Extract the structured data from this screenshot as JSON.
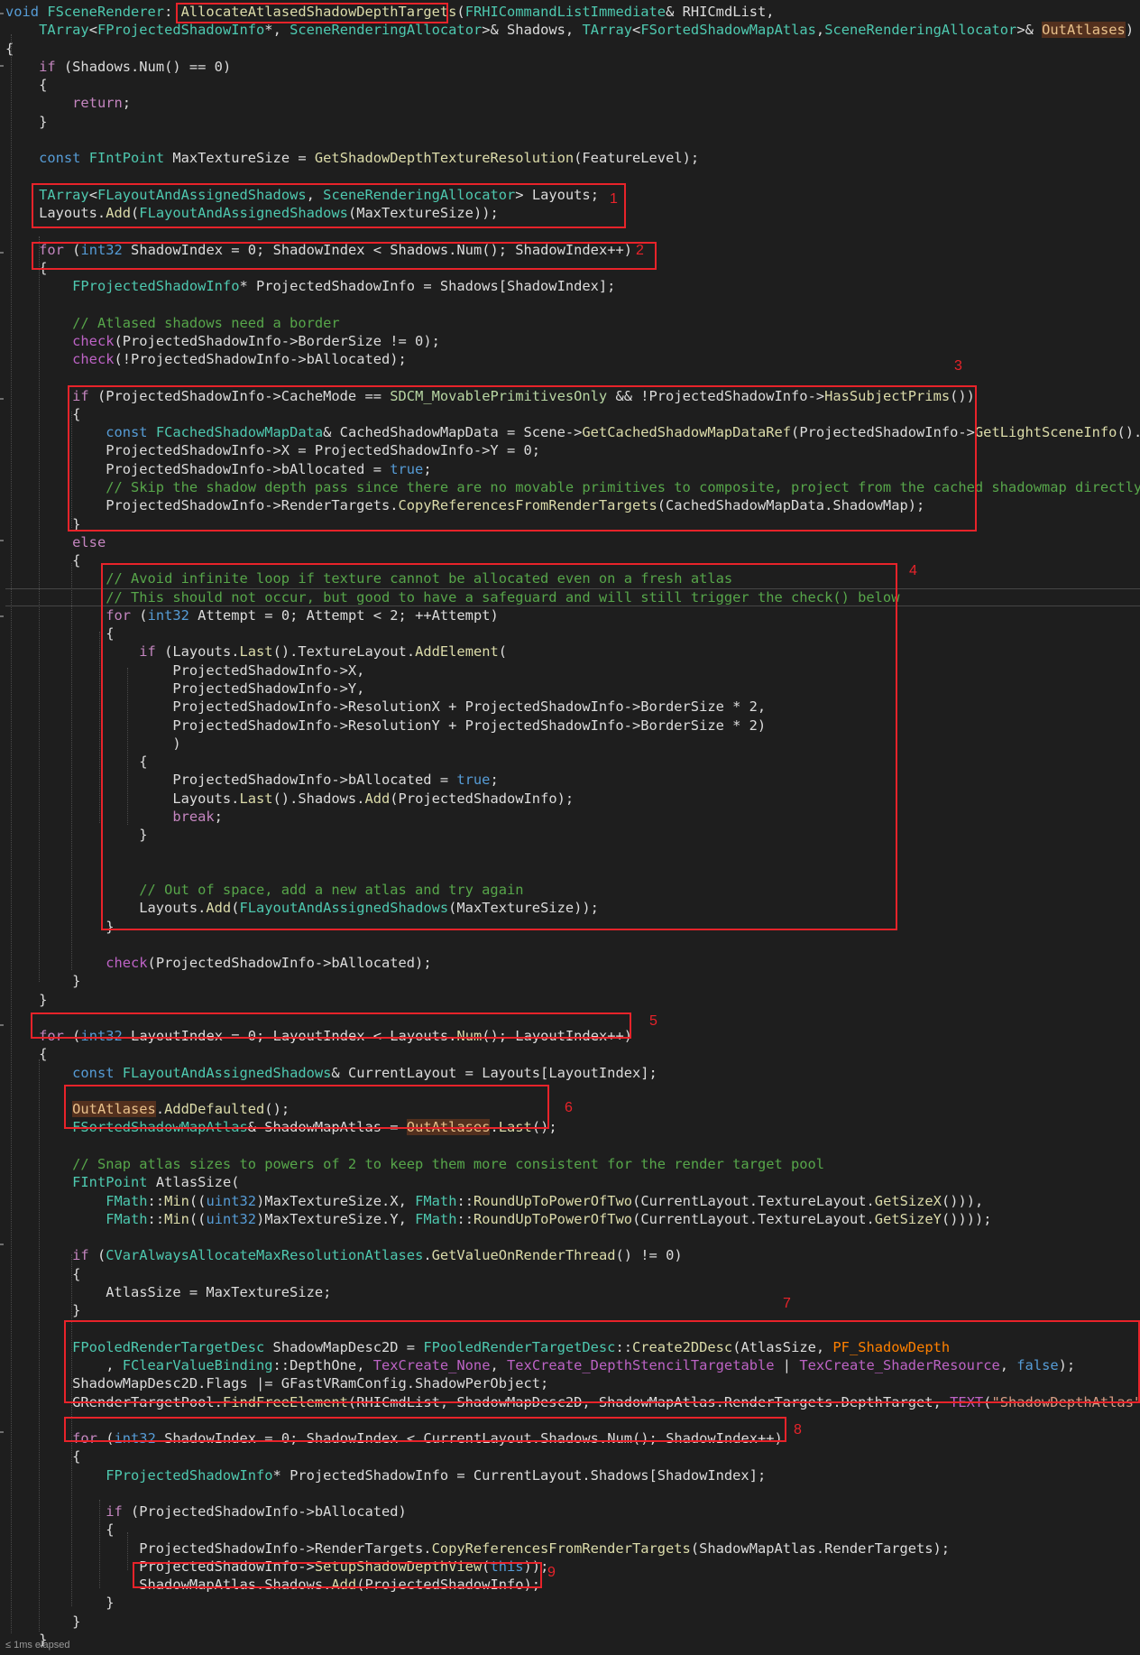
{
  "code": {
    "lines": [
      [
        [
          "k",
          "void "
        ],
        [
          "t",
          "FSceneRenderer"
        ],
        [
          "",
          "::"
        ],
        [
          "f",
          "AllocateAtlasedShadowDepthTargets"
        ],
        [
          "",
          "("
        ],
        [
          "t",
          "FRHICommandListImmediate"
        ],
        [
          "",
          "& RHICmdList,"
        ]
      ],
      [
        [
          "",
          "    "
        ],
        [
          "t",
          "TArray"
        ],
        [
          "",
          "<"
        ],
        [
          "t",
          "FProjectedShadowInfo"
        ],
        [
          "",
          "*, "
        ],
        [
          "t",
          "SceneRenderingAllocator"
        ],
        [
          "",
          ">& Shadows, "
        ],
        [
          "t",
          "TArray"
        ],
        [
          "",
          "<"
        ],
        [
          "t",
          "FSortedShadowMapAtlas"
        ],
        [
          "",
          ","
        ],
        [
          "t",
          "SceneRenderingAllocator"
        ],
        [
          "",
          ">& "
        ],
        [
          "o",
          "OutAtlases"
        ],
        [
          "",
          ")"
        ]
      ],
      [
        [
          "",
          "{"
        ]
      ],
      [
        [
          "",
          "    "
        ],
        [
          "c",
          "if"
        ],
        [
          "",
          " (Shadows.Num() == 0)"
        ]
      ],
      [
        [
          "",
          "    {"
        ]
      ],
      [
        [
          "",
          "        "
        ],
        [
          "c",
          "return"
        ],
        [
          "",
          ";"
        ]
      ],
      [
        [
          "",
          "    }"
        ]
      ],
      [
        [
          "",
          ""
        ]
      ],
      [
        [
          "",
          "    "
        ],
        [
          "k",
          "const "
        ],
        [
          "t",
          "FIntPoint"
        ],
        [
          "",
          " MaxTextureSize = "
        ],
        [
          "f",
          "GetShadowDepthTextureResolution"
        ],
        [
          "",
          "(FeatureLevel);"
        ]
      ],
      [
        [
          "",
          ""
        ]
      ],
      [
        [
          "",
          "    "
        ],
        [
          "t",
          "TArray"
        ],
        [
          "",
          "<"
        ],
        [
          "t",
          "FLayoutAndAssignedShadows"
        ],
        [
          "",
          ", "
        ],
        [
          "t",
          "SceneRenderingAllocator"
        ],
        [
          "",
          "> Layouts;"
        ]
      ],
      [
        [
          "",
          "    Layouts."
        ],
        [
          "f",
          "Add"
        ],
        [
          "",
          "("
        ],
        [
          "t",
          "FLayoutAndAssignedShadows"
        ],
        [
          "",
          "(MaxTextureSize));"
        ]
      ],
      [
        [
          "",
          ""
        ]
      ],
      [
        [
          "",
          "    "
        ],
        [
          "c",
          "for"
        ],
        [
          "",
          " ("
        ],
        [
          "k",
          "int32"
        ],
        [
          "",
          " ShadowIndex = 0; ShadowIndex < Shadows.Num(); ShadowIndex++)"
        ]
      ],
      [
        [
          "",
          "    {"
        ]
      ],
      [
        [
          "",
          "        "
        ],
        [
          "t",
          "FProjectedShadowInfo"
        ],
        [
          "",
          "* ProjectedShadowInfo = Shadows[ShadowIndex];"
        ]
      ],
      [
        [
          "",
          ""
        ]
      ],
      [
        [
          "",
          "        "
        ],
        [
          "g",
          "// Atlased shadows need a border"
        ]
      ],
      [
        [
          "",
          "        "
        ],
        [
          "x",
          "check"
        ],
        [
          "",
          "(ProjectedShadowInfo->BorderSize != 0);"
        ]
      ],
      [
        [
          "",
          "        "
        ],
        [
          "x",
          "check"
        ],
        [
          "",
          "(!ProjectedShadowInfo->bAllocated);"
        ]
      ],
      [
        [
          "",
          ""
        ]
      ],
      [
        [
          "",
          "        "
        ],
        [
          "c",
          "if"
        ],
        [
          "",
          " (ProjectedShadowInfo->CacheMode == "
        ],
        [
          "e",
          "SDCM_MovablePrimitivesOnly"
        ],
        [
          "",
          " && !ProjectedShadowInfo->"
        ],
        [
          "f",
          "HasSubjectPrims"
        ],
        [
          "",
          "())"
        ]
      ],
      [
        [
          "",
          "        {"
        ]
      ],
      [
        [
          "",
          "            "
        ],
        [
          "k",
          "const "
        ],
        [
          "t",
          "FCachedShadowMapData"
        ],
        [
          "",
          "& CachedShadowMapData = Scene->"
        ],
        [
          "f",
          "GetCachedShadowMapDataRef"
        ],
        [
          "",
          "(ProjectedShadowInfo->"
        ],
        [
          "f",
          "GetLightSceneInfo"
        ],
        [
          "",
          "().Id);"
        ]
      ],
      [
        [
          "",
          "            ProjectedShadowInfo->X = ProjectedShadowInfo->Y = 0;"
        ]
      ],
      [
        [
          "",
          "            ProjectedShadowInfo->bAllocated = "
        ],
        [
          "k",
          "true"
        ],
        [
          "",
          ";"
        ]
      ],
      [
        [
          "",
          "            "
        ],
        [
          "g",
          "// Skip the shadow depth pass since there are no movable primitives to composite, project from the cached shadowmap directly which"
        ]
      ],
      [
        [
          "",
          "            ProjectedShadowInfo->RenderTargets."
        ],
        [
          "f",
          "CopyReferencesFromRenderTargets"
        ],
        [
          "",
          "(CachedShadowMapData.ShadowMap);"
        ]
      ],
      [
        [
          "",
          "        }"
        ]
      ],
      [
        [
          "",
          "        "
        ],
        [
          "c",
          "else"
        ]
      ],
      [
        [
          "",
          "        {"
        ]
      ],
      [
        [
          "",
          "            "
        ],
        [
          "g",
          "// Avoid infinite loop if texture cannot be allocated even on a fresh atlas"
        ]
      ],
      [
        [
          "",
          "            "
        ],
        [
          "g",
          "// This should not occur, but good to have a safeguard and will still trigger the check() below"
        ]
      ],
      [
        [
          "",
          "            "
        ],
        [
          "c",
          "for"
        ],
        [
          "",
          " ("
        ],
        [
          "k",
          "int32"
        ],
        [
          "",
          " Attempt = 0; Attempt < 2; ++Attempt)"
        ]
      ],
      [
        [
          "",
          "            {"
        ]
      ],
      [
        [
          "",
          "                "
        ],
        [
          "c",
          "if"
        ],
        [
          "",
          " (Layouts."
        ],
        [
          "f",
          "Last"
        ],
        [
          "",
          "().TextureLayout."
        ],
        [
          "f",
          "AddElement"
        ],
        [
          "",
          "("
        ]
      ],
      [
        [
          "",
          "                    ProjectedShadowInfo->X,"
        ]
      ],
      [
        [
          "",
          "                    ProjectedShadowInfo->Y,"
        ]
      ],
      [
        [
          "",
          "                    ProjectedShadowInfo->ResolutionX + ProjectedShadowInfo->BorderSize * 2,"
        ]
      ],
      [
        [
          "",
          "                    ProjectedShadowInfo->ResolutionY + ProjectedShadowInfo->BorderSize * 2)"
        ]
      ],
      [
        [
          "",
          "                    )"
        ]
      ],
      [
        [
          "",
          "                {"
        ]
      ],
      [
        [
          "",
          "                    ProjectedShadowInfo->bAllocated = "
        ],
        [
          "k",
          "true"
        ],
        [
          "",
          ";"
        ]
      ],
      [
        [
          "",
          "                    Layouts."
        ],
        [
          "f",
          "Last"
        ],
        [
          "",
          "().Shadows."
        ],
        [
          "f",
          "Add"
        ],
        [
          "",
          "(ProjectedShadowInfo);"
        ]
      ],
      [
        [
          "",
          "                    "
        ],
        [
          "c",
          "break"
        ],
        [
          "",
          ";"
        ]
      ],
      [
        [
          "",
          "                }"
        ]
      ],
      [
        [
          "",
          ""
        ]
      ],
      [
        [
          "",
          ""
        ]
      ],
      [
        [
          "",
          "                "
        ],
        [
          "g",
          "// Out of space, add a new atlas and try again"
        ]
      ],
      [
        [
          "",
          "                Layouts."
        ],
        [
          "f",
          "Add"
        ],
        [
          "",
          "("
        ],
        [
          "t",
          "FLayoutAndAssignedShadows"
        ],
        [
          "",
          "(MaxTextureSize));"
        ]
      ],
      [
        [
          "",
          "            }"
        ]
      ],
      [
        [
          "",
          ""
        ]
      ],
      [
        [
          "",
          "            "
        ],
        [
          "x",
          "check"
        ],
        [
          "",
          "(ProjectedShadowInfo->bAllocated);"
        ]
      ],
      [
        [
          "",
          "        }"
        ]
      ],
      [
        [
          "",
          "    }"
        ]
      ],
      [
        [
          "",
          ""
        ]
      ],
      [
        [
          "",
          "    "
        ],
        [
          "c",
          "for"
        ],
        [
          "",
          " ("
        ],
        [
          "k",
          "int32"
        ],
        [
          "",
          " LayoutIndex = 0; LayoutIndex < Layouts."
        ],
        [
          "f",
          "Num"
        ],
        [
          "",
          "(); LayoutIndex++)"
        ]
      ],
      [
        [
          "",
          "    {"
        ]
      ],
      [
        [
          "",
          "        "
        ],
        [
          "k",
          "const "
        ],
        [
          "t",
          "FLayoutAndAssignedShadows"
        ],
        [
          "",
          "& CurrentLayout = Layouts[LayoutIndex];"
        ]
      ],
      [
        [
          "",
          ""
        ]
      ],
      [
        [
          "",
          "        "
        ],
        [
          "o",
          "OutAtlases"
        ],
        [
          "",
          "."
        ],
        [
          "f",
          "AddDefaulted"
        ],
        [
          "",
          "();"
        ]
      ],
      [
        [
          "",
          "        "
        ],
        [
          "t",
          "FSortedShadowMapAtlas"
        ],
        [
          "",
          "& ShadowMapAtlas = "
        ],
        [
          "o",
          "OutAtlases"
        ],
        [
          "",
          "."
        ],
        [
          "f",
          "Last"
        ],
        [
          "",
          "();"
        ]
      ],
      [
        [
          "",
          ""
        ]
      ],
      [
        [
          "",
          "        "
        ],
        [
          "g",
          "// Snap atlas sizes to powers of 2 to keep them more consistent for the render target pool"
        ]
      ],
      [
        [
          "",
          "        "
        ],
        [
          "t",
          "FIntPoint"
        ],
        [
          "",
          " AtlasSize("
        ]
      ],
      [
        [
          "",
          "            "
        ],
        [
          "t",
          "FMath"
        ],
        [
          "",
          "::"
        ],
        [
          "f",
          "Min"
        ],
        [
          "",
          "(("
        ],
        [
          "k",
          "uint32"
        ],
        [
          "",
          ")MaxTextureSize.X, "
        ],
        [
          "t",
          "FMath"
        ],
        [
          "",
          "::"
        ],
        [
          "f",
          "RoundUpToPowerOfTwo"
        ],
        [
          "",
          "(CurrentLayout.TextureLayout."
        ],
        [
          "f",
          "GetSizeX"
        ],
        [
          "",
          "())),"
        ]
      ],
      [
        [
          "",
          "            "
        ],
        [
          "t",
          "FMath"
        ],
        [
          "",
          "::"
        ],
        [
          "f",
          "Min"
        ],
        [
          "",
          "(("
        ],
        [
          "k",
          "uint32"
        ],
        [
          "",
          ")MaxTextureSize.Y, "
        ],
        [
          "t",
          "FMath"
        ],
        [
          "",
          "::"
        ],
        [
          "f",
          "RoundUpToPowerOfTwo"
        ],
        [
          "",
          "(CurrentLayout.TextureLayout."
        ],
        [
          "f",
          "GetSizeY"
        ],
        [
          "",
          "())));"
        ]
      ],
      [
        [
          "",
          ""
        ]
      ],
      [
        [
          "",
          "        "
        ],
        [
          "c",
          "if"
        ],
        [
          "",
          " ("
        ],
        [
          "t",
          "CVarAlwaysAllocateMaxResolutionAtlases"
        ],
        [
          "",
          "."
        ],
        [
          "f",
          "GetValueOnRenderThread"
        ],
        [
          "",
          "() != 0)"
        ]
      ],
      [
        [
          "",
          "        {"
        ]
      ],
      [
        [
          "",
          "            AtlasSize = MaxTextureSize;"
        ]
      ],
      [
        [
          "",
          "        }"
        ]
      ],
      [
        [
          "",
          ""
        ]
      ],
      [
        [
          "",
          "        "
        ],
        [
          "t",
          "FPooledRenderTargetDesc"
        ],
        [
          "",
          " ShadowMapDesc2D = "
        ],
        [
          "t",
          "FPooledRenderTargetDesc"
        ],
        [
          "",
          "::"
        ],
        [
          "f",
          "Create2DDesc"
        ],
        [
          "",
          "(AtlasSize, "
        ],
        [
          "m",
          "PF_ShadowDepth"
        ]
      ],
      [
        [
          "",
          "            , "
        ],
        [
          "t",
          "FClearValueBinding"
        ],
        [
          "",
          "::DepthOne, "
        ],
        [
          "x",
          "TexCreate_None"
        ],
        [
          "",
          ", "
        ],
        [
          "x",
          "TexCreate_DepthStencilTargetable"
        ],
        [
          "",
          " | "
        ],
        [
          "x",
          "TexCreate_ShaderResource"
        ],
        [
          "",
          ", "
        ],
        [
          "k",
          "false"
        ],
        [
          "",
          ");"
        ]
      ],
      [
        [
          "",
          "        ShadowMapDesc2D.Flags |= GFastVRamConfig.ShadowPerObject;"
        ]
      ],
      [
        [
          "",
          "        GRenderTargetPool."
        ],
        [
          "f",
          "FindFreeElement"
        ],
        [
          "",
          "(RHICmdList, ShadowMapDesc2D, ShadowMapAtlas.RenderTargets.DepthTarget, "
        ],
        [
          "x",
          "TEXT"
        ],
        [
          "",
          "("
        ],
        [
          "s",
          "\"ShadowDepthAtlas\""
        ],
        [
          "",
          "));"
        ]
      ],
      [
        [
          "",
          ""
        ]
      ],
      [
        [
          "",
          "        "
        ],
        [
          "c",
          "for"
        ],
        [
          "",
          " ("
        ],
        [
          "k",
          "int32"
        ],
        [
          "",
          " ShadowIndex = 0; ShadowIndex < CurrentLayout.Shadows.Num(); ShadowIndex++)"
        ]
      ],
      [
        [
          "",
          "        {"
        ]
      ],
      [
        [
          "",
          "            "
        ],
        [
          "t",
          "FProjectedShadowInfo"
        ],
        [
          "",
          "* ProjectedShadowInfo = CurrentLayout.Shadows[ShadowIndex];"
        ]
      ],
      [
        [
          "",
          ""
        ]
      ],
      [
        [
          "",
          "            "
        ],
        [
          "c",
          "if"
        ],
        [
          "",
          " (ProjectedShadowInfo->bAllocated)"
        ]
      ],
      [
        [
          "",
          "            {"
        ]
      ],
      [
        [
          "",
          "                ProjectedShadowInfo->RenderTargets."
        ],
        [
          "f",
          "CopyReferencesFromRenderTargets"
        ],
        [
          "",
          "(ShadowMapAtlas.RenderTargets);"
        ]
      ],
      [
        [
          "",
          "                ProjectedShadowInfo->"
        ],
        [
          "f",
          "SetupShadowDepthView"
        ],
        [
          "",
          "("
        ],
        [
          "k",
          "this"
        ],
        [
          "",
          "));"
        ]
      ],
      [
        [
          "",
          "                ShadowMapAtlas.Shadows."
        ],
        [
          "f",
          "Add"
        ],
        [
          "",
          "(ProjectedShadowInfo);"
        ]
      ],
      [
        [
          "",
          "            }"
        ]
      ],
      [
        [
          "",
          "        }"
        ]
      ],
      [
        [
          "",
          "    }"
        ]
      ]
    ]
  },
  "annotations": [
    "1",
    "2",
    "3",
    "4",
    "5",
    "6",
    "7",
    "8",
    "9"
  ],
  "status": {
    "elapsed": "≤ 1ms elapsed"
  },
  "colors": {
    "background": "#1e1e1e",
    "annotation": "#e8232a"
  }
}
